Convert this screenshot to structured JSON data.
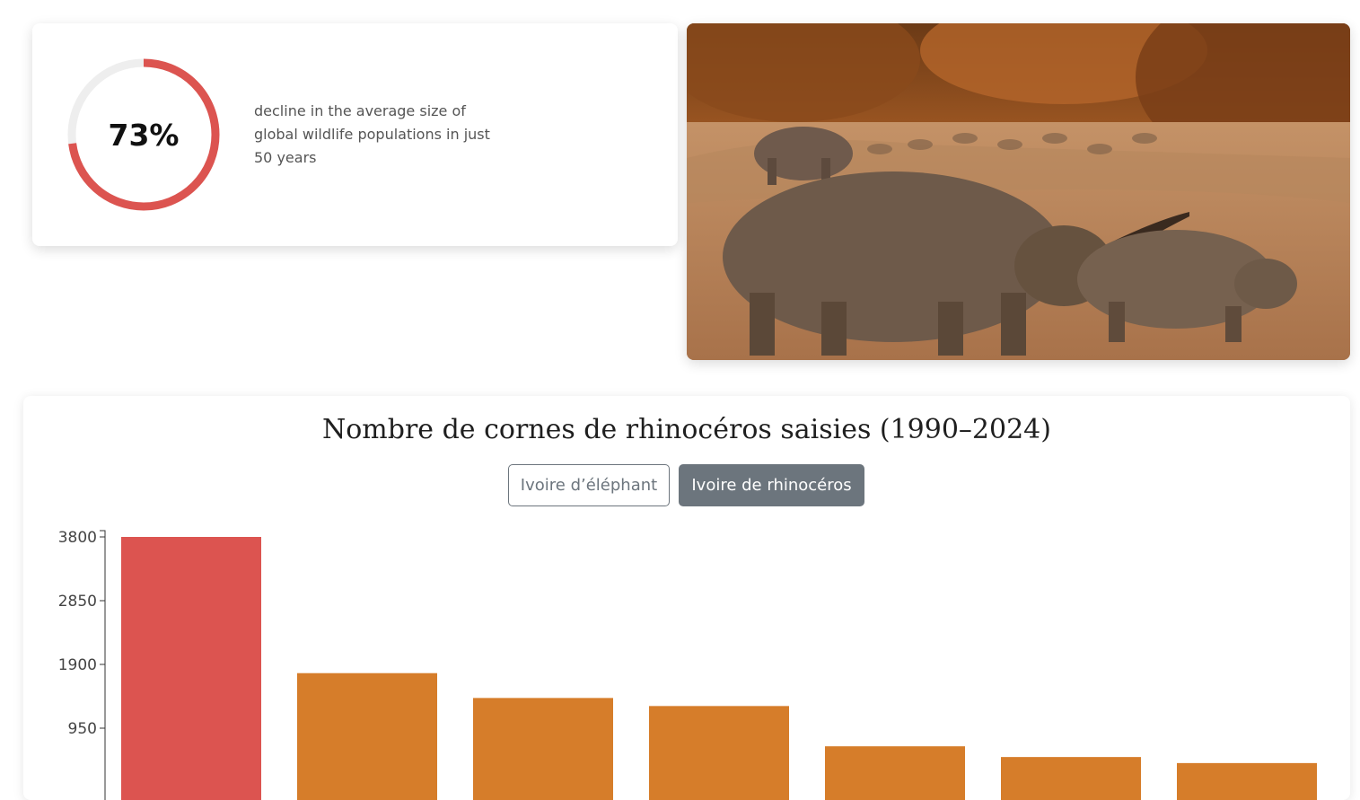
{
  "stat": {
    "value_label": "73%",
    "percent": 73,
    "description": "decline in the average size of global wildlife populations in just 50 years",
    "ring_color": "#dc5450",
    "track_color": "#eeeeee"
  },
  "photo": {
    "icon": "rhinoceros-photo"
  },
  "toggle": {
    "elephant_label": "Ivoire d’éléphant",
    "rhino_label": "Ivoire de rhinocéros",
    "active": "rhino"
  },
  "chart_data": {
    "type": "bar",
    "title": "Nombre de cornes de rhinocéros saisies (1990–2024)",
    "xlabel": "",
    "ylabel": "",
    "ylim": [
      0,
      3800
    ],
    "y_ticks": [
      "3800",
      "2850",
      "1900",
      "950"
    ],
    "values": [
      3800,
      1770,
      1400,
      1280,
      680,
      520,
      430
    ],
    "colors": [
      "#dc5450",
      "#d67d2a",
      "#d67d2a",
      "#d67d2a",
      "#d67d2a",
      "#d67d2a",
      "#d67d2a"
    ],
    "grid": false
  }
}
